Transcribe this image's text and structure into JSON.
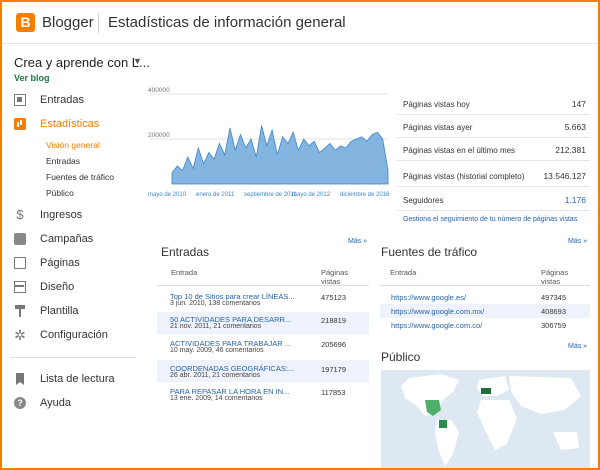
{
  "header": {
    "logo_letter": "B",
    "app_name": "Blogger",
    "title": "Estadísticas de información general"
  },
  "sidebar": {
    "blog_name": "Crea y aprende con L...",
    "view_blog": "Ver blog",
    "items": [
      {
        "label": "Entradas",
        "icon": "posts-icon"
      },
      {
        "label": "Estadísticas",
        "icon": "stats-icon",
        "active": true
      },
      {
        "label": "Ingresos",
        "icon": "earnings-icon"
      },
      {
        "label": "Campañas",
        "icon": "campaigns-icon"
      },
      {
        "label": "Páginas",
        "icon": "pages-icon"
      },
      {
        "label": "Diseño",
        "icon": "layout-icon"
      },
      {
        "label": "Plantilla",
        "icon": "theme-icon"
      },
      {
        "label": "Configuración",
        "icon": "settings-icon"
      },
      {
        "label": "Lista de lectura",
        "icon": "reading-list-icon"
      },
      {
        "label": "Ayuda",
        "icon": "help-icon"
      }
    ],
    "stats_subitems": [
      "Visión general",
      "Entradas",
      "Fuentes de tráfico",
      "Público"
    ]
  },
  "chart_data": {
    "type": "area",
    "color": "#6fa8dc",
    "ylim": [
      0,
      400000
    ],
    "y_ticks": [
      "400000",
      "200000"
    ],
    "x_ticks": [
      "mayo de 2010",
      "enero de 2011",
      "septiembre de 2011",
      "mayo de 2012",
      "diciembre de 2016"
    ],
    "values": [
      50000,
      80000,
      60000,
      120000,
      70000,
      160000,
      90000,
      140000,
      110000,
      180000,
      130000,
      250000,
      150000,
      220000,
      160000,
      200000,
      120000,
      260000,
      170000,
      240000,
      130000,
      210000,
      180000,
      230000,
      150000,
      200000,
      170000,
      190000,
      140000,
      160000,
      180000,
      150000,
      170000,
      160000,
      190000,
      200000,
      210000,
      190000,
      220000,
      230000,
      200000,
      60000
    ]
  },
  "stats": [
    {
      "label": "Páginas vistas hoy",
      "value": "147"
    },
    {
      "label": "Páginas vistas ayer",
      "value": "5.663"
    },
    {
      "label": "Páginas vistas en el último mes",
      "value": "212.381"
    },
    {
      "label": "Páginas vistas (historial completo)",
      "value": "13.546.127"
    },
    {
      "label": "Seguidores",
      "value": "1.176"
    }
  ],
  "track_link": "Gestiona el seguimiento de tu número de páginas vistas",
  "more_label": "Más »",
  "posts": {
    "title": "Entradas",
    "col_entry": "Entrada",
    "col_views_1": "Páginas",
    "col_views_2": "vistas",
    "rows": [
      {
        "title": "Top 10 de Sitios para crear LÍNEAS...",
        "meta": "3 jun. 2010, 138 comentarios",
        "views": "475123"
      },
      {
        "title": "50 ACTIVIDADES PARA DESARR...",
        "meta": "21 nov. 2011, 21 comentarios",
        "views": "218819"
      },
      {
        "title": "ACTIVIDADES PARA TRABAJAR ...",
        "meta": "10 may. 2009, 46 comentarios",
        "views": "205696"
      },
      {
        "title": "COORDENADAS GEOGRÁFICAS:...",
        "meta": "26 abr. 2011, 21 comentarios",
        "views": "197179"
      },
      {
        "title": "PARA REPASAR LA HORA EN IN...",
        "meta": "13 ene. 2009, 14 comentarios",
        "views": "117853"
      }
    ]
  },
  "traffic": {
    "title": "Fuentes de tráfico",
    "col_entry": "Entrada",
    "col_views_1": "Páginas",
    "col_views_2": "vistas",
    "rows": [
      {
        "url": "https://www.google.es/",
        "views": "497345"
      },
      {
        "url": "https://www.google.com.mx/",
        "views": "408693"
      },
      {
        "url": "https://www.google.com.co/",
        "views": "306759"
      }
    ]
  },
  "audience": {
    "title": "Público"
  }
}
